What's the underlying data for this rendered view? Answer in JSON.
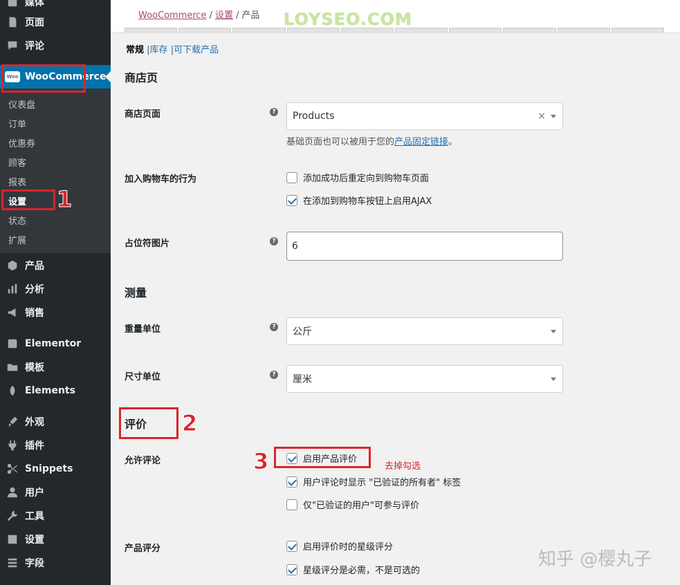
{
  "sidebar": {
    "items_top": [
      {
        "label": "媒体",
        "icon": "media-icon"
      },
      {
        "label": "页面",
        "icon": "page-icon"
      },
      {
        "label": "评论",
        "icon": "comment-icon"
      }
    ],
    "woo": {
      "label": "WooCommerce",
      "logo": "Woo"
    },
    "woo_sub": [
      "仪表盘",
      "订单",
      "优惠券",
      "顾客",
      "报表",
      "设置",
      "状态",
      "扩展"
    ],
    "items_bottom": [
      {
        "label": "产品",
        "icon": "product-icon"
      },
      {
        "label": "分析",
        "icon": "analytics-icon"
      },
      {
        "label": "销售",
        "icon": "marketing-icon"
      },
      {
        "label": "Elementor",
        "icon": "elementor-icon"
      },
      {
        "label": "模板",
        "icon": "folder-icon"
      },
      {
        "label": "Elements",
        "icon": "elements-icon"
      },
      {
        "label": "外观",
        "icon": "brush-icon"
      },
      {
        "label": "插件",
        "icon": "plugin-icon"
      },
      {
        "label": "Snippets",
        "icon": "scissors-icon"
      },
      {
        "label": "用户",
        "icon": "user-icon"
      },
      {
        "label": "工具",
        "icon": "wrench-icon"
      },
      {
        "label": "设置",
        "icon": "settings-icon"
      },
      {
        "label": "字段",
        "icon": "fields-icon"
      }
    ]
  },
  "breadcrumb": {
    "root": "WooCommerce",
    "sep": "/",
    "parent": "设置",
    "current": "产品"
  },
  "watermark_top": "LOYSEO.COM",
  "subnav": {
    "current": "常规",
    "link1": "库存",
    "link2": "可下载产品",
    "sep": "|"
  },
  "sections": {
    "shop": "商店页",
    "measure": "测量",
    "reviews": "评价"
  },
  "fields": {
    "shop_page": {
      "label": "商店页面",
      "value": "Products",
      "clear": "×",
      "desc_prefix": "基础页面也可以被用于您的",
      "desc_link": "产品固定链接",
      "desc_suffix": "。"
    },
    "cart_behavior": {
      "label": "加入购物车的行为",
      "opt1": "添加成功后重定向到购物车页面",
      "opt2": "在添加到购物车按钮上启用AJAX"
    },
    "placeholder": {
      "label": "占位符图片",
      "value": "6"
    },
    "weight": {
      "label": "重量单位",
      "value": "公斤"
    },
    "dimension": {
      "label": "尺寸单位",
      "value": "厘米"
    },
    "allow_reviews": {
      "label": "允许评论",
      "opt1": "启用产品评价",
      "opt2": "用户评论时显示 \"已验证的所有者\" 标签",
      "opt3": "仅\"已验证的用户\"可参与评价"
    },
    "ratings": {
      "label": "产品评分",
      "opt1": "启用评价时的星级评分",
      "opt2": "星级评分是必需，不是可选的"
    }
  },
  "help_glyph": "?",
  "annotations": {
    "n1": "1",
    "n2": "2",
    "n3": "3",
    "note": "去掉勾选"
  },
  "watermark_bottom": "知乎 @樱丸子"
}
